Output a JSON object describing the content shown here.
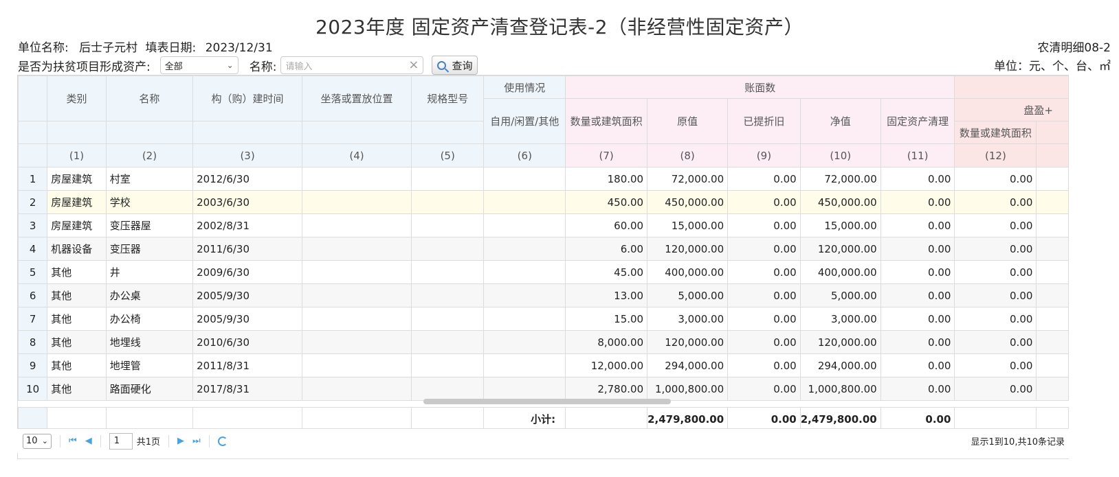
{
  "title": "2023年度 固定资产清查登记表-2（非经营性固定资产）",
  "info": {
    "unit_label": "单位名称:",
    "unit_value": "后士子元村",
    "date_label": "填表日期:",
    "date_value": "2023/12/31",
    "form_code": "农清明细08-2",
    "unit_measure": "单位：元、个、台、㎡"
  },
  "filters": {
    "poverty_label": "是否为扶贫项目形成资产:",
    "poverty_value": "全部",
    "name_label": "名称:",
    "name_placeholder": "请输入",
    "query_label": "查询"
  },
  "headers": {
    "category": "类别",
    "name": "名称",
    "build_time": "构（购）建时间",
    "location": "坐落或置放位置",
    "spec": "规格型号",
    "usage_group": "使用情况",
    "usage": "自用/闲置/其他",
    "book_group": "账面数",
    "quantity": "数量或建筑面积",
    "original": "原值",
    "depreciation": "已提折旧",
    "net": "净值",
    "cleanup": "固定资产清理",
    "surplus_group": "盘盈",
    "surplus_qty": "数量或建筑面积"
  },
  "col_numbers": [
    "(1)",
    "(2)",
    "(3)",
    "(4)",
    "(5)",
    "(6)",
    "(7)",
    "(8)",
    "(9)",
    "(10)",
    "(11)",
    "(12)"
  ],
  "rows": [
    {
      "no": "1",
      "category": "房屋建筑",
      "name": "村室",
      "date": "2012/6/30",
      "qty": "180.00",
      "original": "72,000.00",
      "dep": "0.00",
      "net": "72,000.00",
      "clean": "0.00",
      "s_qty": "0.00"
    },
    {
      "no": "2",
      "category": "房屋建筑",
      "name": "学校",
      "date": "2003/6/30",
      "qty": "450.00",
      "original": "450,000.00",
      "dep": "0.00",
      "net": "450,000.00",
      "clean": "0.00",
      "s_qty": "0.00"
    },
    {
      "no": "3",
      "category": "房屋建筑",
      "name": "变压器屋",
      "date": "2002/8/31",
      "qty": "60.00",
      "original": "15,000.00",
      "dep": "0.00",
      "net": "15,000.00",
      "clean": "0.00",
      "s_qty": "0.00"
    },
    {
      "no": "4",
      "category": "机器设备",
      "name": "变压器",
      "date": "2011/6/30",
      "qty": "6.00",
      "original": "120,000.00",
      "dep": "0.00",
      "net": "120,000.00",
      "clean": "0.00",
      "s_qty": "0.00"
    },
    {
      "no": "5",
      "category": "其他",
      "name": "井",
      "date": "2009/6/30",
      "qty": "45.00",
      "original": "400,000.00",
      "dep": "0.00",
      "net": "400,000.00",
      "clean": "0.00",
      "s_qty": "0.00"
    },
    {
      "no": "6",
      "category": "其他",
      "name": "办公桌",
      "date": "2005/9/30",
      "qty": "13.00",
      "original": "5,000.00",
      "dep": "0.00",
      "net": "5,000.00",
      "clean": "0.00",
      "s_qty": "0.00"
    },
    {
      "no": "7",
      "category": "其他",
      "name": "办公椅",
      "date": "2005/9/30",
      "qty": "15.00",
      "original": "3,000.00",
      "dep": "0.00",
      "net": "3,000.00",
      "clean": "0.00",
      "s_qty": "0.00"
    },
    {
      "no": "8",
      "category": "其他",
      "name": "地埋线",
      "date": "2010/6/30",
      "qty": "8,000.00",
      "original": "120,000.00",
      "dep": "0.00",
      "net": "120,000.00",
      "clean": "0.00",
      "s_qty": "0.00"
    },
    {
      "no": "9",
      "category": "其他",
      "name": "地埋管",
      "date": "2011/8/31",
      "qty": "12,000.00",
      "original": "294,000.00",
      "dep": "0.00",
      "net": "294,000.00",
      "clean": "0.00",
      "s_qty": "0.00"
    },
    {
      "no": "10",
      "category": "其他",
      "name": "路面硬化",
      "date": "2017/8/31",
      "qty": "2,780.00",
      "original": "1,000,800.00",
      "dep": "0.00",
      "net": "1,000,800.00",
      "clean": "0.00",
      "s_qty": "0.00"
    }
  ],
  "footer": {
    "label": "小计:",
    "original": "2,479,800.00",
    "dep": "0.00",
    "net": "2,479,800.00",
    "clean": "0.00"
  },
  "pager": {
    "page_size": "10",
    "current_page": "1",
    "total_pages": "共1页",
    "info": "显示1到10,共10条记录"
  }
}
